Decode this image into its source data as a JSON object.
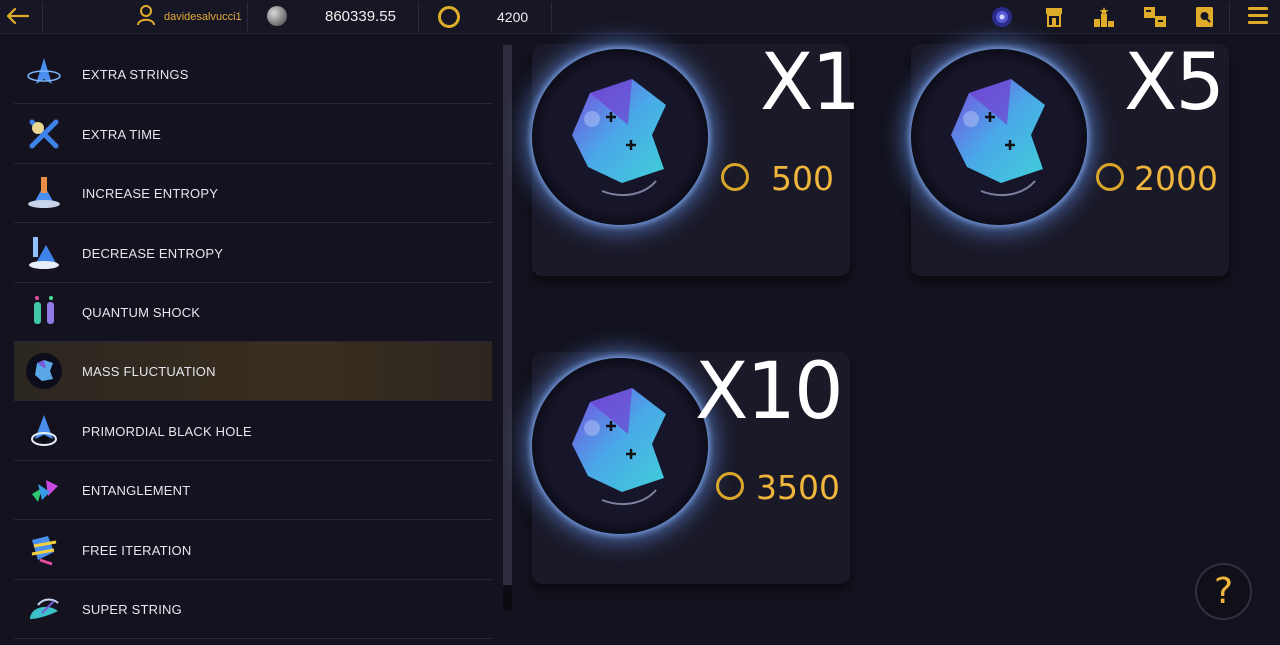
{
  "header": {
    "username": "davidesalvucci1",
    "balance": "860339.55",
    "coins": "4200"
  },
  "sidebar": {
    "items": [
      {
        "label": "EXTRA STRINGS",
        "icon": "extra-strings-icon"
      },
      {
        "label": "EXTRA TIME",
        "icon": "extra-time-icon"
      },
      {
        "label": "INCREASE ENTROPY",
        "icon": "increase-entropy-icon"
      },
      {
        "label": "DECREASE ENTROPY",
        "icon": "decrease-entropy-icon"
      },
      {
        "label": "QUANTUM SHOCK",
        "icon": "quantum-shock-icon"
      },
      {
        "label": "MASS FLUCTUATION",
        "icon": "mass-fluctuation-icon",
        "active": true
      },
      {
        "label": "PRIMORDIAL BLACK HOLE",
        "icon": "primordial-black-hole-icon"
      },
      {
        "label": "ENTANGLEMENT",
        "icon": "entanglement-icon"
      },
      {
        "label": "FREE ITERATION",
        "icon": "free-iteration-icon"
      },
      {
        "label": "SUPER STRING",
        "icon": "super-string-icon"
      }
    ]
  },
  "offers": [
    {
      "multiplier": "X1",
      "price": "500"
    },
    {
      "multiplier": "X5",
      "price": "2000"
    },
    {
      "multiplier": "X10",
      "price": "3500"
    }
  ],
  "help": {
    "label": "?"
  },
  "colors": {
    "accent": "#e0ad2a",
    "price": "#f0b53c",
    "glow": "#6ea0ff",
    "background": "#13121e"
  }
}
